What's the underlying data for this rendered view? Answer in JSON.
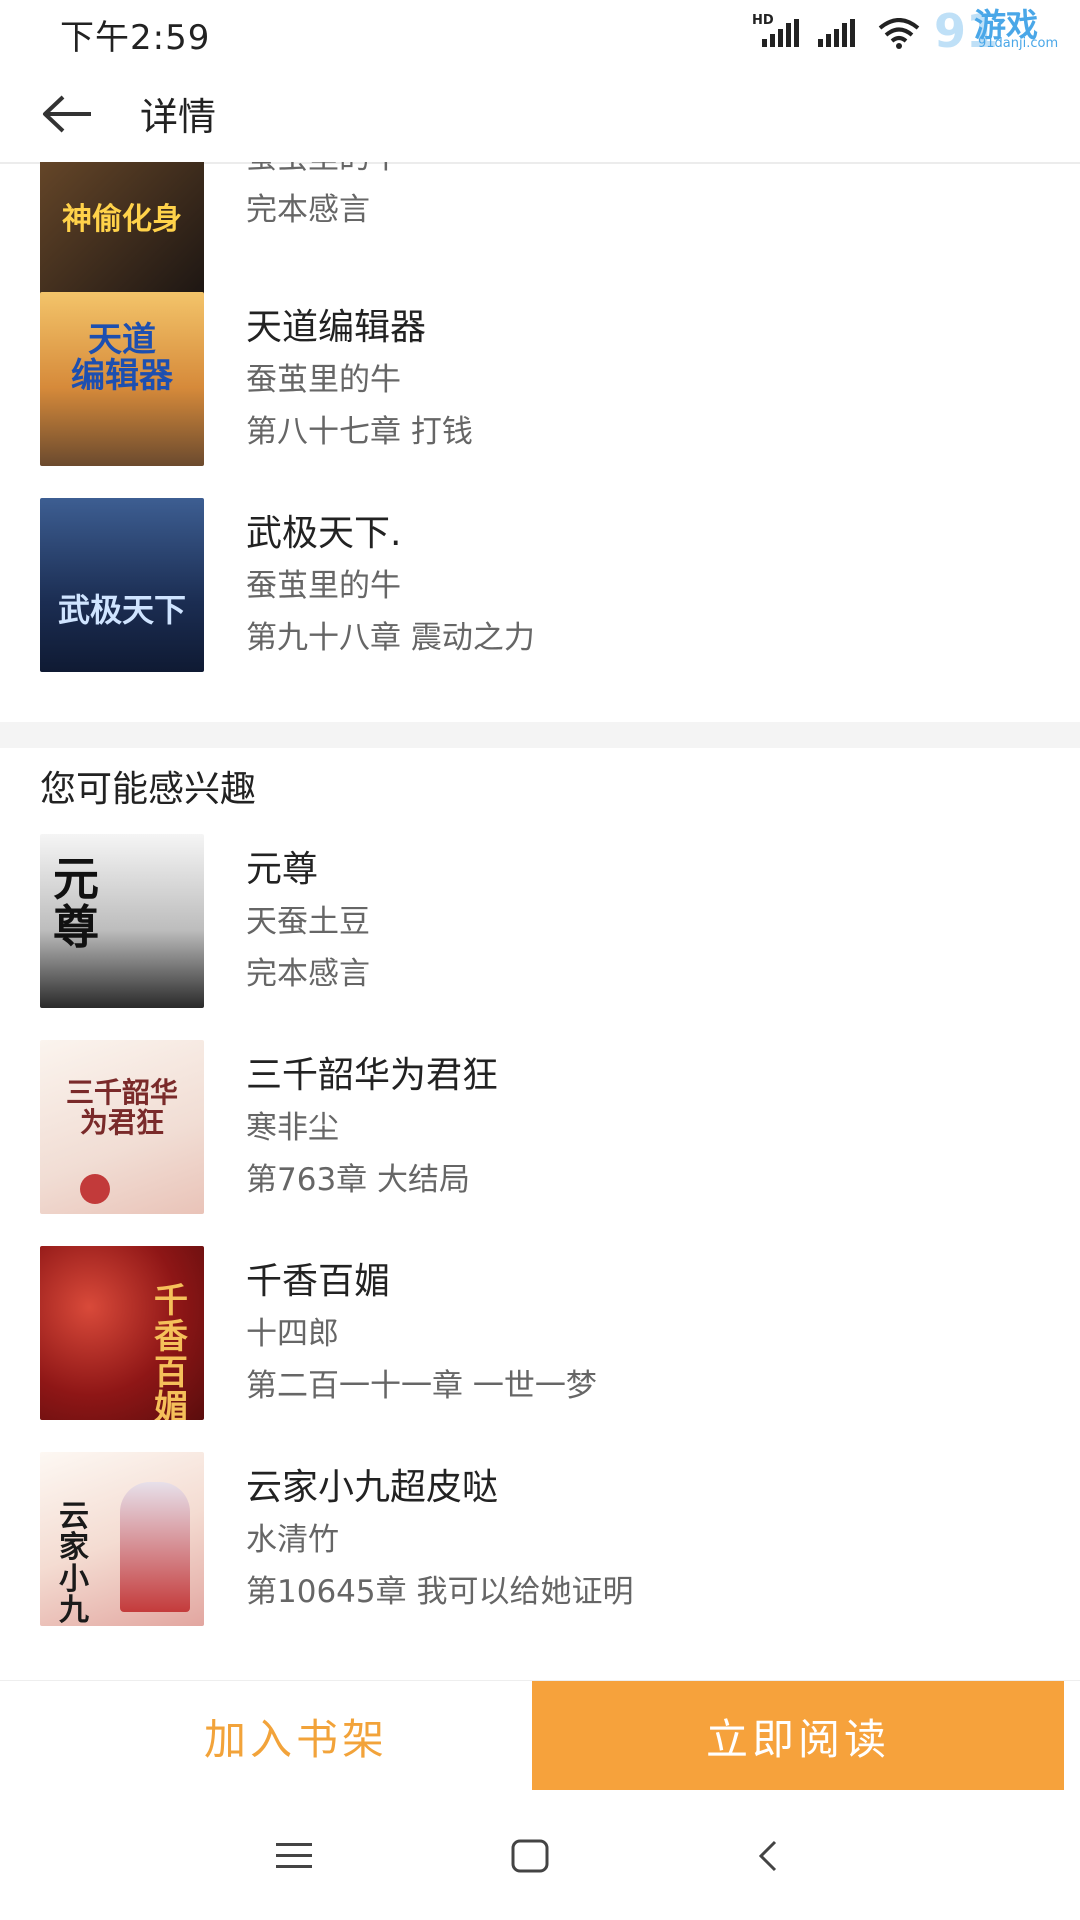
{
  "status_bar": {
    "time": "下午2:59",
    "hd_label": "HD",
    "watermark": {
      "logo": "91",
      "text": "游戏",
      "sub": "91danji.com"
    }
  },
  "header": {
    "title": "详情",
    "back_icon": "arrow-left-icon"
  },
  "author_books": [
    {
      "title": "",
      "author": "蚕茧里的牛",
      "chapter": "完本感言",
      "cover_text": "神偷化身",
      "cover_color": "#3a2a1c"
    },
    {
      "title": "天道编辑器",
      "author": "蚕茧里的牛",
      "chapter": "第八十七章 打钱",
      "cover_text": "天道\n编辑器",
      "cover_color": "#d8a24a"
    },
    {
      "title": "武极天下.",
      "author": "蚕茧里的牛",
      "chapter": "第九十八章 震动之力",
      "cover_text": "武极天下",
      "cover_color": "#1e3b66"
    }
  ],
  "recommend": {
    "heading": "您可能感兴趣",
    "books": [
      {
        "title": "元尊",
        "author": "天蚕土豆",
        "chapter": "完本感言",
        "cover_text": "元尊",
        "cover_color": "#2b2b2b"
      },
      {
        "title": "三千韶华为君狂",
        "author": "寒非尘",
        "chapter": "第763章 大结局",
        "cover_text": "三千韶华\n为君狂",
        "cover_color": "#f3e8e2"
      },
      {
        "title": "千香百媚",
        "author": "十四郎",
        "chapter": "第二百一十一章 一世一梦",
        "cover_text": "千香百媚",
        "cover_color": "#9e1b1b"
      },
      {
        "title": "云家小九超皮哒",
        "author": "水清竹",
        "chapter": "第10645章 我可以给她证明",
        "cover_text": "云家小九",
        "cover_color": "#f6efe9"
      }
    ]
  },
  "bottom_bar": {
    "add_shelf": "加入书架",
    "read_now": "立即阅读"
  },
  "colors": {
    "accent": "#f6a23c",
    "accent_text": "#f2a33a"
  }
}
